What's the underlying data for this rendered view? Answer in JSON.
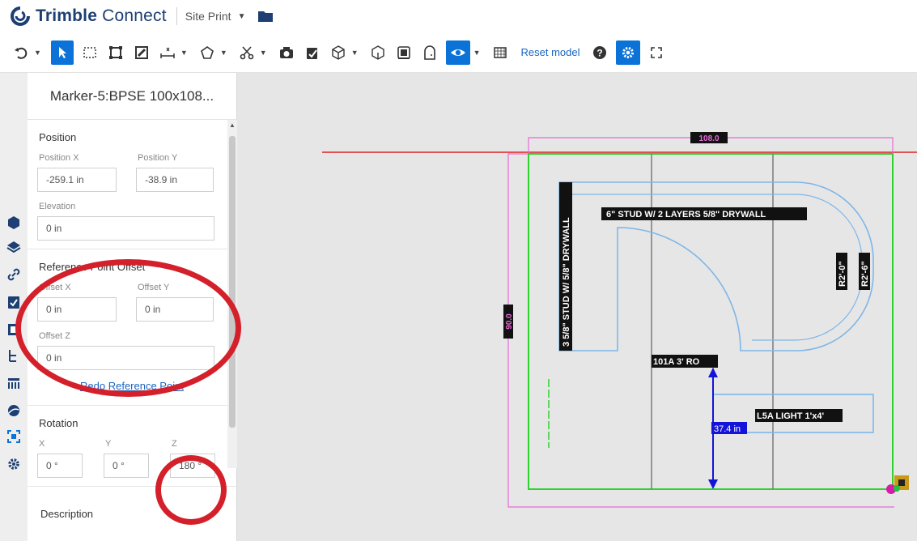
{
  "header": {
    "brand_bold": "Trimble",
    "brand_light": " Connect",
    "project_name": "Site Print"
  },
  "toolbar": {
    "reset_model_label": "Reset model"
  },
  "panel": {
    "title": "Marker-5:BPSE 100x108...",
    "position": {
      "section_title": "Position",
      "x_label": "Position X",
      "x_value": "-259.1 in",
      "y_label": "Position Y",
      "y_value": "-38.9 in",
      "elevation_label": "Elevation",
      "elevation_value": "0 in"
    },
    "reference_offset": {
      "section_title": "Reference Point Offset",
      "x_label": "Offset X",
      "x_value": "0 in",
      "y_label": "Offset Y",
      "y_value": "0 in",
      "z_label": "Offset Z",
      "z_value": "0 in",
      "redo_link": "Redo Reference Point"
    },
    "rotation": {
      "section_title": "Rotation",
      "x_label": "X",
      "x_value": "0 °",
      "y_label": "Y",
      "y_value": "0 °",
      "z_label": "Z",
      "z_value": "180 °"
    },
    "description_title": "Description"
  },
  "drawing": {
    "top_dimension": "108.0",
    "left_dimension": "90.0",
    "wall_label_top": "6\" STUD W/ 2 LAYERS 5/8\" DRYWALL",
    "wall_label_left": "3 5/8\" STUD W/ 5/8\" DRYWALL",
    "radius_label_1": "R2'-0\"",
    "radius_label_2": "R2'-6\"",
    "door_label": "101A 3' RO",
    "light_label": "L5A LIGHT 1'x4'",
    "measure_label": "37.4 in"
  },
  "colors": {
    "accent": "#0b73d8",
    "brand": "#1d3f73",
    "annotation_red": "#d4202a",
    "boundary_green": "#2fd12f",
    "outline_magenta": "#e86ad8",
    "wall_blue": "#7eb6e8",
    "ref_line_red": "#e02020",
    "measure_blue": "#1414d8"
  }
}
